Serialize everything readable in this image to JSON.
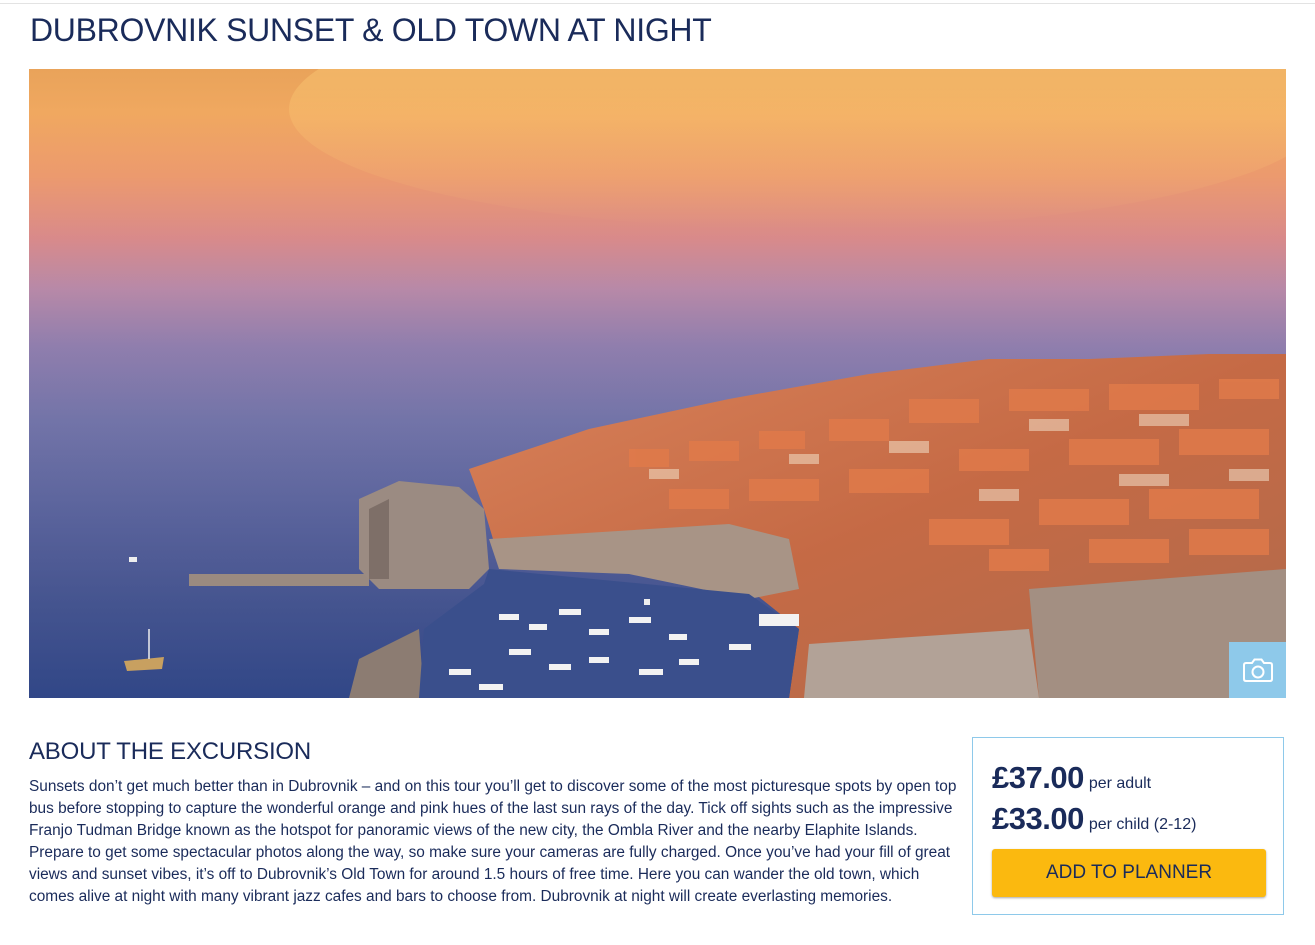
{
  "page": {
    "title": "DUBROVNIK SUNSET & OLD TOWN AT NIGHT"
  },
  "hero": {
    "image_description_icon": "camera-icon",
    "gallery_button_icon": "camera-icon"
  },
  "about": {
    "heading": "ABOUT THE EXCURSION",
    "body": "Sunsets don’t get much better than in Dubrovnik – and on this tour you’ll get to discover some of the most picturesque spots by open top bus before stopping to capture the wonderful orange and pink hues of the last sun rays of the day. Tick off sights such as the impressive Franjo Tudman Bridge known as the hotspot for panoramic views of the new city, the Ombla River and the nearby Elaphite Islands. Prepare to get some spectacular photos along the way, so make sure your cameras are fully charged. Once you’ve had your fill of great views and sunset vibes, it’s off to Dubrovnik’s Old Town for around 1.5 hours of free time. Here you can wander the old town, which comes alive at night with many vibrant jazz cafes and bars to choose from. Dubrovnik at night will create everlasting memories."
  },
  "pricing": {
    "adult_price": "£37.00",
    "adult_unit": "per adult",
    "child_price": "£33.00",
    "child_unit": "per child (2-12)",
    "add_button_label": "ADD TO PLANNER"
  },
  "colors": {
    "title_navy": "#1a2b5a",
    "accent_light_blue": "#8ec9ea",
    "button_yellow": "#fbb90f"
  }
}
